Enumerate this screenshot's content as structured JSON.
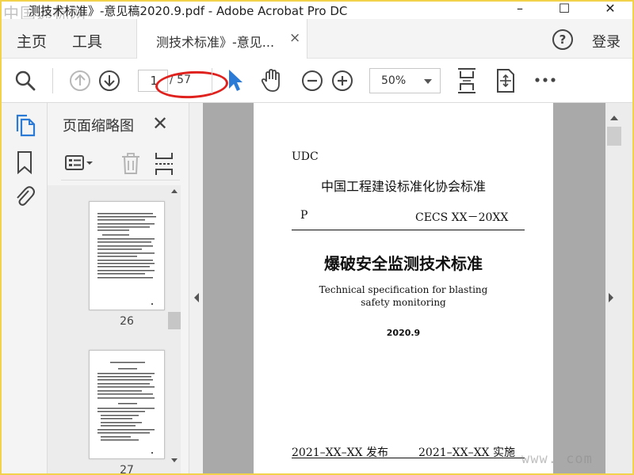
{
  "window": {
    "title": "测技术标准》-意见稿2020.9.pdf - Adobe Acrobat Pro DC",
    "minimize": "–",
    "maximize": "☐",
    "close": "✕"
  },
  "watermark": {
    "top": "中国通标网",
    "bottom": "www.        com"
  },
  "menubar": {
    "home": "主页",
    "tools": "工具",
    "tab_label": "测技术标准》-意见...",
    "tab_close": "×",
    "help": "?",
    "login": "登录"
  },
  "toolbar": {
    "current_page": "1",
    "total_pages": "/ 57",
    "zoom": "50%"
  },
  "thumbnails": {
    "panel_title": "页面缩略图",
    "close": "✕",
    "pages": [
      {
        "number": "26"
      },
      {
        "number": "27"
      }
    ]
  },
  "document": {
    "udc": "UDC",
    "association": "中国工程建设标准化协会标准",
    "p_label": "P",
    "code": "CECS XX－20XX",
    "title_cn": "爆破安全监测技术标准",
    "title_en": "Technical specification for blasting safety monitoring",
    "date": "2020.9",
    "publish": "2021–XX–XX  发布",
    "implement": "2021–XX–XX  实施"
  },
  "colors": {
    "accent_blue": "#2b7bd6",
    "annotation_red": "#e0221f",
    "frame_yellow": "#f2d24a"
  },
  "icons": [
    "search-icon",
    "arrow-up-icon",
    "arrow-down-icon",
    "select-cursor-icon",
    "hand-icon",
    "zoom-out-icon",
    "zoom-in-icon",
    "fit-page-icon",
    "fullscreen-icon",
    "more-icon",
    "pages-icon",
    "bookmark-icon",
    "attachment-icon",
    "thumbnail-options-icon",
    "delete-icon",
    "insert-icon"
  ]
}
